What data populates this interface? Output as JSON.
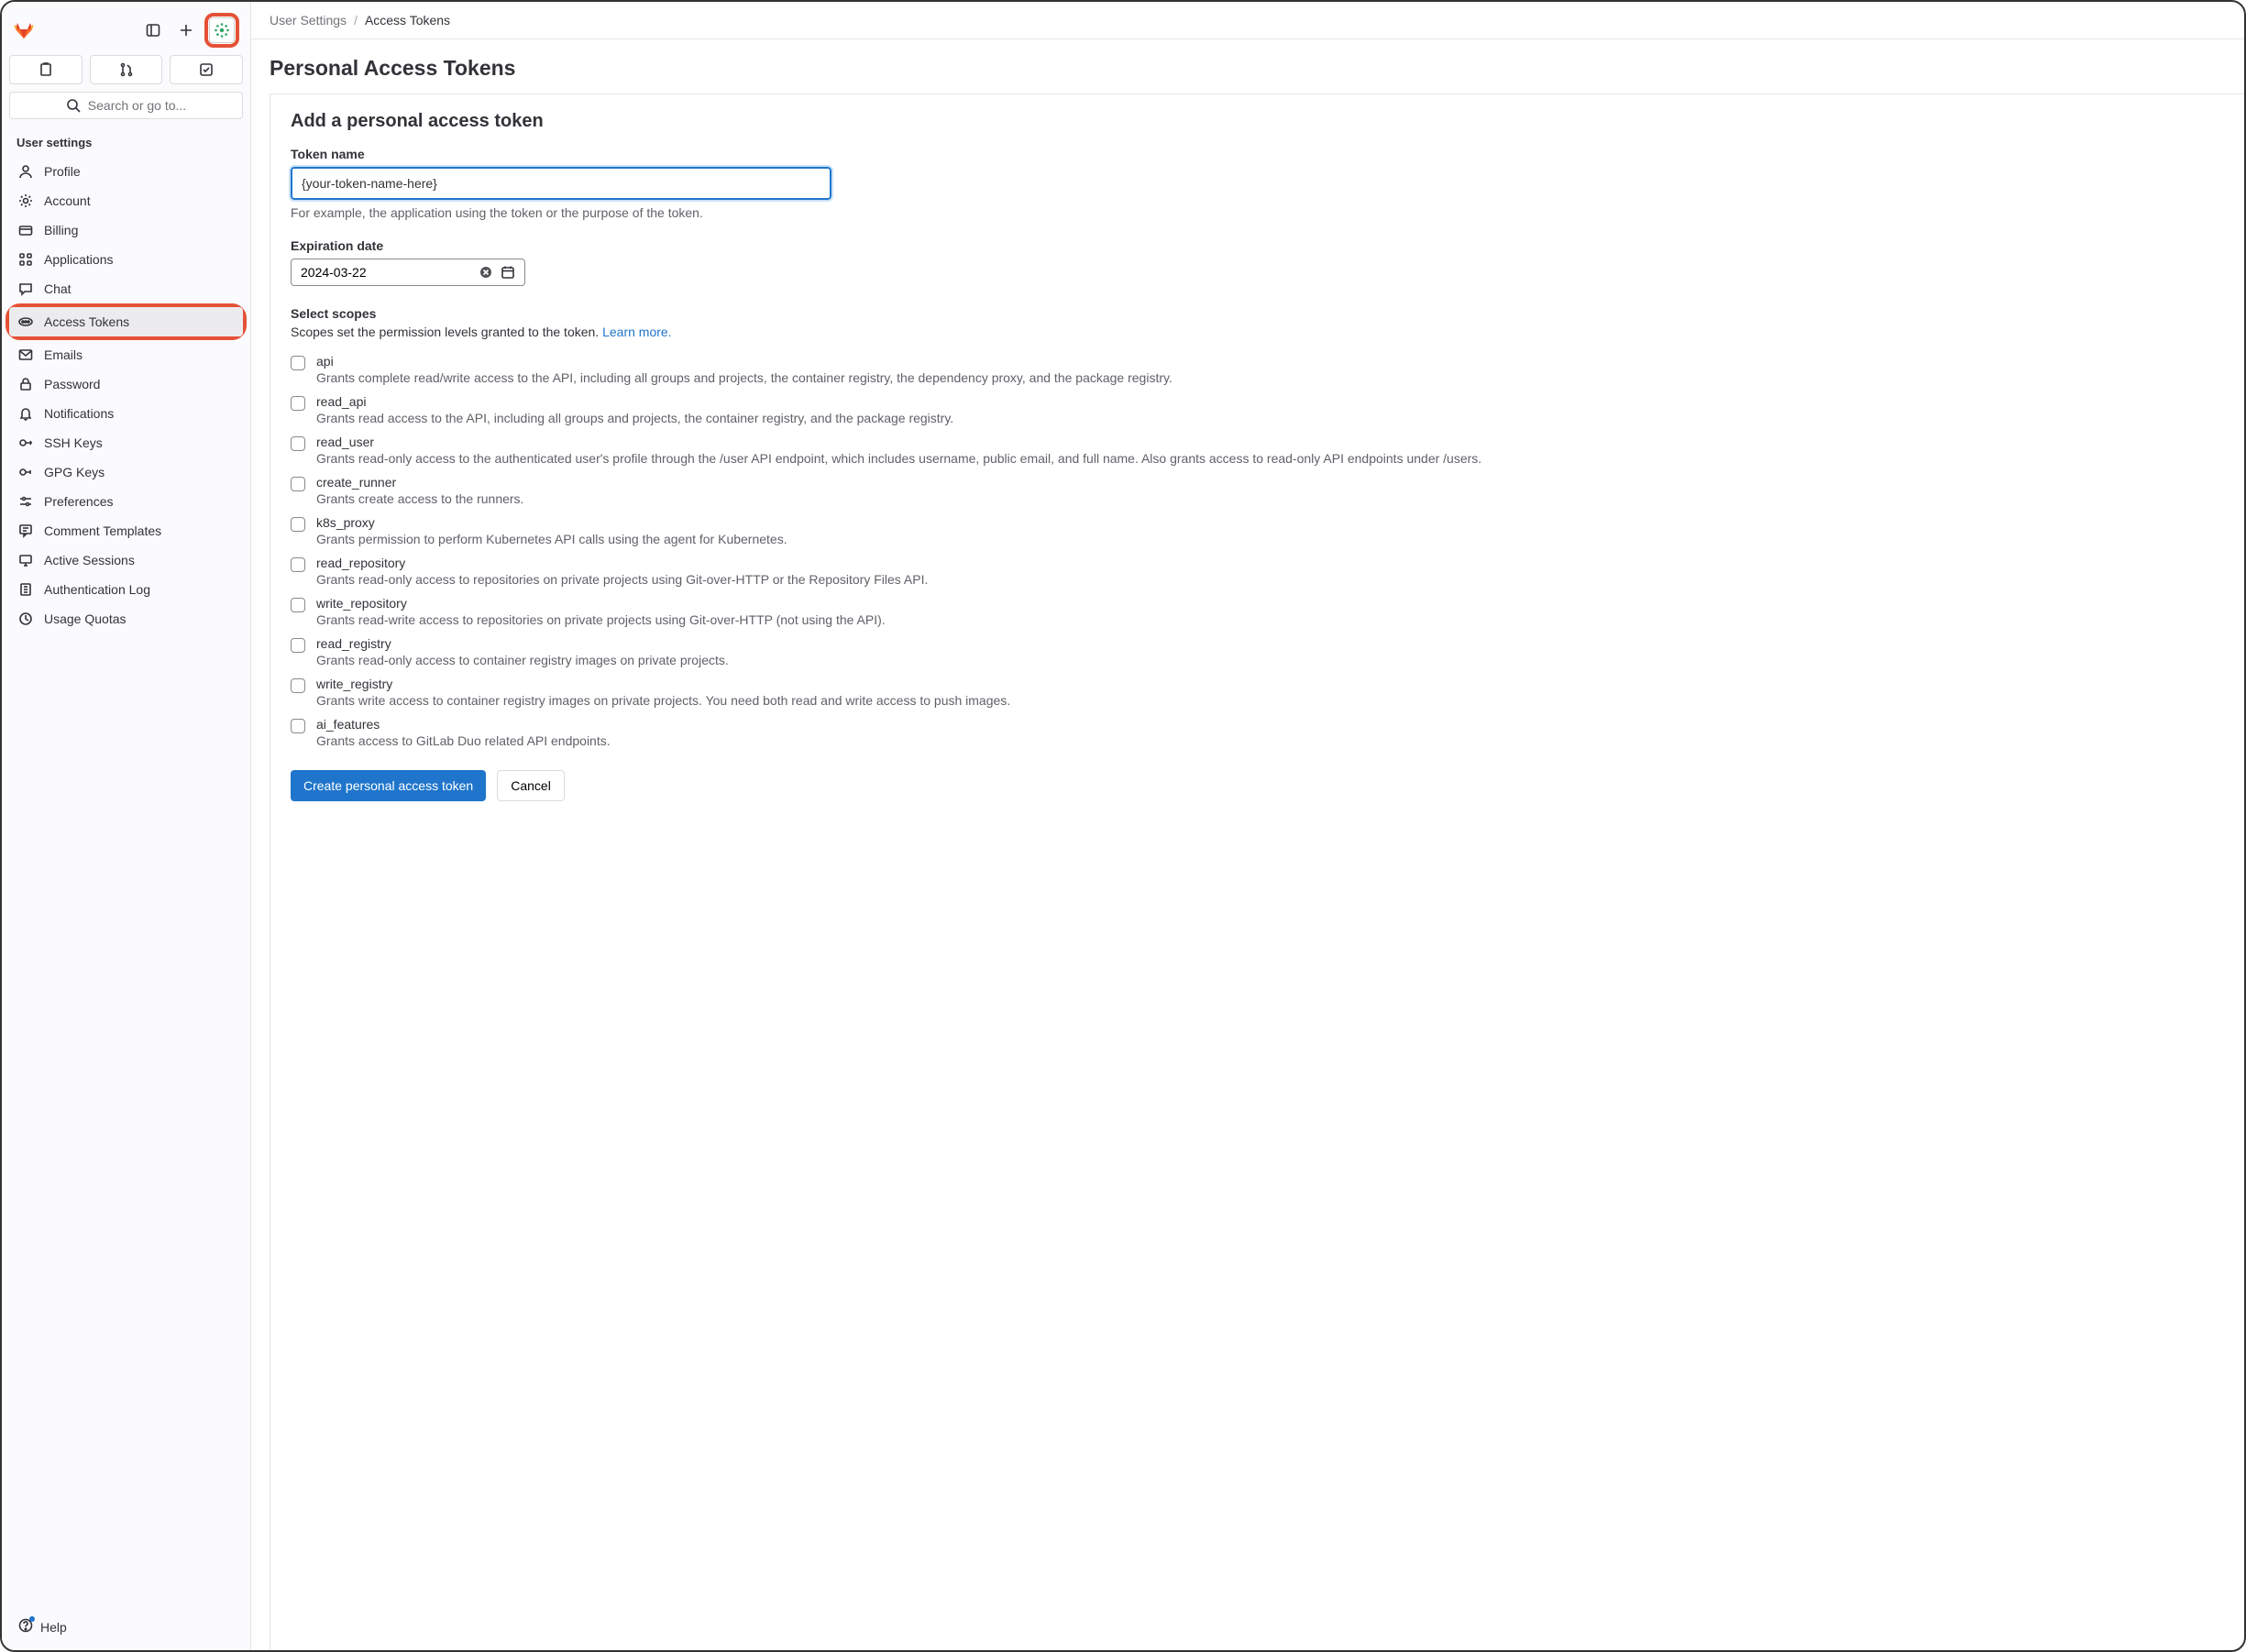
{
  "breadcrumb": {
    "parent": "User Settings",
    "current": "Access Tokens"
  },
  "page_title": "Personal Access Tokens",
  "search": {
    "placeholder": "Search or go to..."
  },
  "sidebar": {
    "section": "User settings",
    "items": [
      {
        "label": "Profile"
      },
      {
        "label": "Account"
      },
      {
        "label": "Billing"
      },
      {
        "label": "Applications"
      },
      {
        "label": "Chat"
      },
      {
        "label": "Access Tokens"
      },
      {
        "label": "Emails"
      },
      {
        "label": "Password"
      },
      {
        "label": "Notifications"
      },
      {
        "label": "SSH Keys"
      },
      {
        "label": "GPG Keys"
      },
      {
        "label": "Preferences"
      },
      {
        "label": "Comment Templates"
      },
      {
        "label": "Active Sessions"
      },
      {
        "label": "Authentication Log"
      },
      {
        "label": "Usage Quotas"
      }
    ],
    "help_label": "Help"
  },
  "form": {
    "title": "Add a personal access token",
    "name_label": "Token name",
    "name_value": "{your-token-name-here}",
    "name_helper": "For example, the application using the token or the purpose of the token.",
    "expiry_label": "Expiration date",
    "expiry_value": "2024-03-22",
    "scopes_label": "Select scopes",
    "scopes_help_prefix": "Scopes set the permission levels granted to the token. ",
    "scopes_help_link": "Learn more.",
    "scopes": [
      {
        "name": "api",
        "desc": "Grants complete read/write access to the API, including all groups and projects, the container registry, the dependency proxy, and the package registry."
      },
      {
        "name": "read_api",
        "desc": "Grants read access to the API, including all groups and projects, the container registry, and the package registry."
      },
      {
        "name": "read_user",
        "desc": "Grants read-only access to the authenticated user's profile through the /user API endpoint, which includes username, public email, and full name. Also grants access to read-only API endpoints under /users."
      },
      {
        "name": "create_runner",
        "desc": "Grants create access to the runners."
      },
      {
        "name": "k8s_proxy",
        "desc": "Grants permission to perform Kubernetes API calls using the agent for Kubernetes."
      },
      {
        "name": "read_repository",
        "desc": "Grants read-only access to repositories on private projects using Git-over-HTTP or the Repository Files API."
      },
      {
        "name": "write_repository",
        "desc": "Grants read-write access to repositories on private projects using Git-over-HTTP (not using the API)."
      },
      {
        "name": "read_registry",
        "desc": "Grants read-only access to container registry images on private projects."
      },
      {
        "name": "write_registry",
        "desc": "Grants write access to container registry images on private projects. You need both read and write access to push images."
      },
      {
        "name": "ai_features",
        "desc": "Grants access to GitLab Duo related API endpoints."
      }
    ],
    "submit_label": "Create personal access token",
    "cancel_label": "Cancel"
  }
}
